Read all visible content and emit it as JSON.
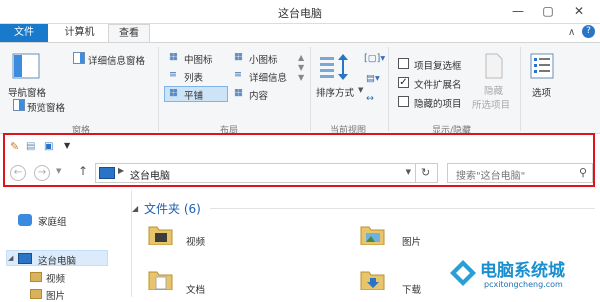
{
  "window": {
    "title": "这台电脑"
  },
  "tabs": {
    "file": "文件",
    "computer": "计算机",
    "view": "查看"
  },
  "ribbon": {
    "panes": {
      "navigation_pane": "导航窗格",
      "preview_pane": "预览窗格",
      "details_pane": "详细信息窗格",
      "group": "窗格"
    },
    "layout": {
      "medium_icons": "中图标",
      "small_icons": "小图标",
      "list": "列表",
      "details": "详细信息",
      "tiles": "平铺",
      "content": "内容",
      "group": "布局"
    },
    "current_view": {
      "sort_by": "排序方式",
      "group": "当前视图"
    },
    "show_hide": {
      "item_checkboxes": "项目复选框",
      "file_extensions": "文件扩展名",
      "hidden_items": "隐藏的项目",
      "hide": "隐藏",
      "selected_items": "所选项目",
      "group": "显示/隐藏",
      "item_checkboxes_checked": false,
      "file_extensions_checked": true,
      "hidden_items_checked": false
    },
    "options": "选项"
  },
  "address": {
    "location": "这台电脑",
    "search_placeholder": "搜索\"这台电脑\""
  },
  "nav": {
    "homegroup": "家庭组",
    "this_pc": "这台电脑",
    "videos": "视频",
    "pictures": "图片"
  },
  "main": {
    "folders_header": "文件夹 (6)",
    "items": [
      "视频",
      "图片",
      "文档",
      "下载"
    ]
  },
  "watermark": {
    "text_cn": "电脑系统城",
    "text_en": "pcxitongcheng.com"
  },
  "colors": {
    "file_tab": "#1979ca",
    "highlight": "#e0131c",
    "accent": "#1c5fb0"
  }
}
